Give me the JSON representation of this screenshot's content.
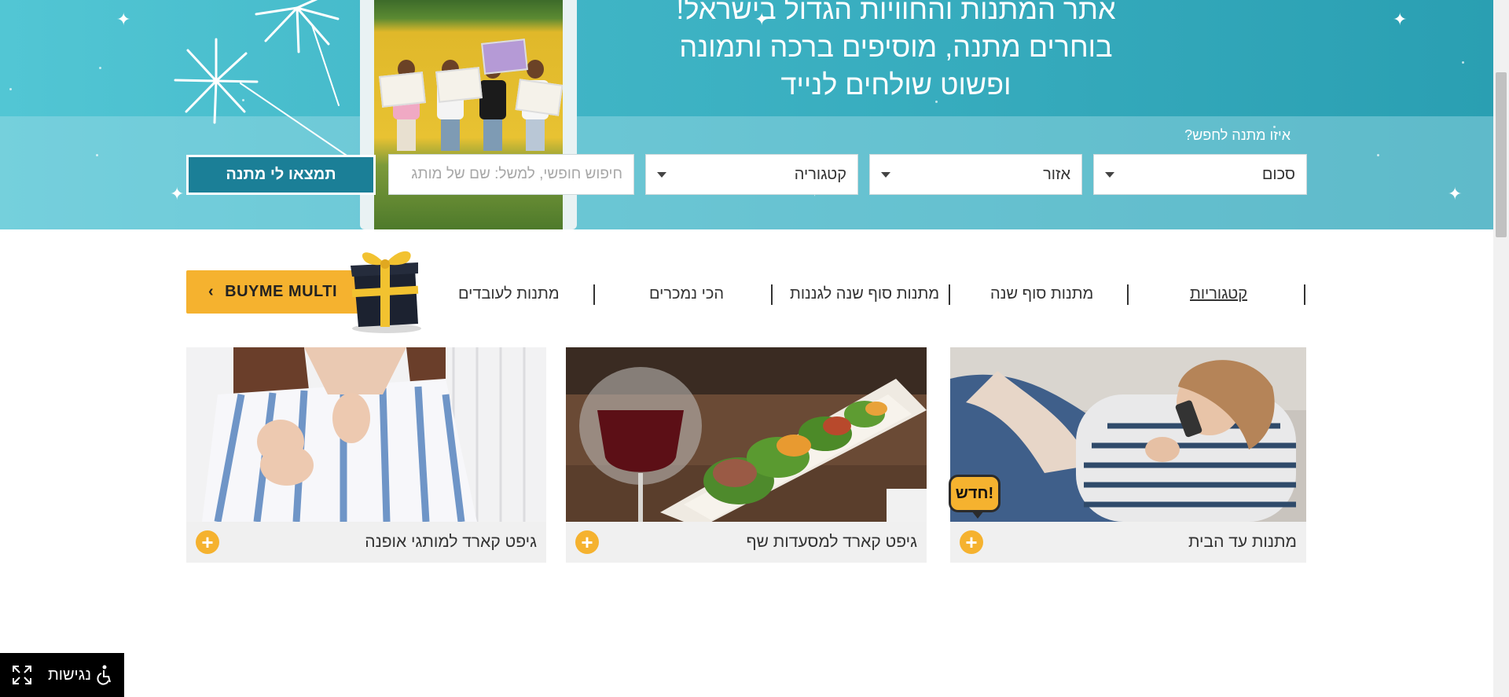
{
  "hero": {
    "headline_line1": "אתר המתנות והחוויות הגדול בישראל!",
    "headline_line2": "בוחרים מתנה, מוסיפים ברכה ותמונה",
    "headline_line3": "ופשוט שולחים לנייד"
  },
  "search": {
    "question": "איזו מתנה לחפש?",
    "amount_select": "סכום",
    "area_select": "אזור",
    "category_select": "קטגוריה",
    "free_text_placeholder": "חיפוש חופשי, למשל: שם של מותג",
    "submit_label": "תמצאו לי מתנה"
  },
  "nav": {
    "items": [
      {
        "label": "קטגוריות",
        "active": true
      },
      {
        "label": "מתנות סוף שנה"
      },
      {
        "label": "מתנות סוף שנה לגננות"
      },
      {
        "label": "הכי נמכרים"
      },
      {
        "label": "מתנות לעובדים"
      }
    ],
    "multi_label": "BUYME MULTI"
  },
  "cards": [
    {
      "title": "מתנות עד הבית",
      "badge": "חדש!"
    },
    {
      "title": "גיפט קארד למסעדות שף"
    },
    {
      "title": "גיפט קארד למותגי אופנה"
    }
  ],
  "accessibility": {
    "label": "נגישות"
  },
  "colors": {
    "accent": "#f5b22f",
    "primary_button": "#1b7f97",
    "hero_bg": "#3fb4c5"
  }
}
